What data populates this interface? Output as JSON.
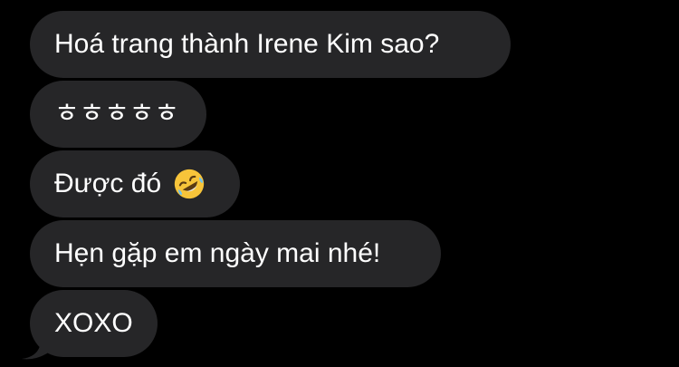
{
  "messages": [
    {
      "text": "Hoá trang thành Irene Kim sao?"
    },
    {
      "text": "ㅎㅎㅎㅎㅎ"
    },
    {
      "text": "Được đó",
      "emoji": "rolling-on-the-floor-laughing-emoji"
    },
    {
      "text": "Hẹn gặp em ngày mai nhé!"
    },
    {
      "text": "XOXO"
    }
  ],
  "colors": {
    "background": "#000000",
    "bubble": "#262628",
    "text": "#ffffff",
    "emoji_face": "#f7c43a"
  }
}
